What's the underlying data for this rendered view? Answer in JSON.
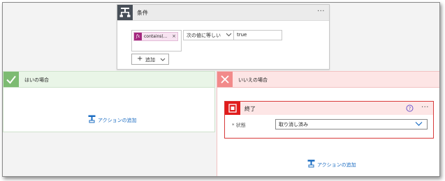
{
  "condition": {
    "title": "条件",
    "more_label": "···",
    "token": {
      "fx_label": "fx",
      "label": "contains(...",
      "close_label": "×"
    },
    "operator": "次の値に等しい",
    "right_value": "true",
    "add_label": "追加"
  },
  "yes_branch": {
    "title": "はいの場合",
    "add_action_label": "アクションの追加"
  },
  "no_branch": {
    "title": "いいえの場合",
    "add_action_label": "アクションの追加",
    "terminate": {
      "title": "終了",
      "more_label": "···",
      "status_label": "* 状態",
      "status_value": "取り消し済み"
    }
  },
  "colors": {
    "yes_accent": "#7dbb72",
    "no_accent": "#f28a8a",
    "terminate_accent": "#e01b1b",
    "expression_token": "#a3277e",
    "link": "#1b6cc2"
  },
  "icons": {
    "condition": "condition-icon",
    "yes": "check-icon",
    "no": "x-icon",
    "terminate": "terminate-icon",
    "help": "help-icon",
    "add_action": "add-action-icon"
  }
}
